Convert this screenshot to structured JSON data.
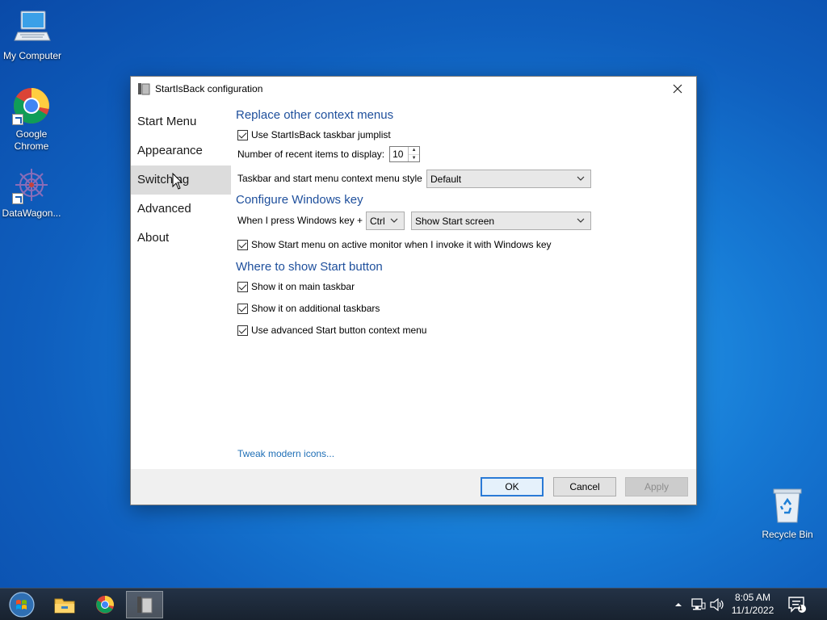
{
  "desktop": {
    "icons": [
      {
        "label": "My Computer",
        "icon": "computer-icon"
      },
      {
        "label": "Google Chrome",
        "icon": "chrome-icon"
      },
      {
        "label": "DataWagon...",
        "icon": "datawagon-icon"
      },
      {
        "label": "Recycle Bin",
        "icon": "recycle-bin-icon"
      }
    ]
  },
  "window": {
    "title": "StartIsBack configuration",
    "nav": [
      {
        "label": "Start Menu"
      },
      {
        "label": "Appearance"
      },
      {
        "label": "Switching",
        "selected": true
      },
      {
        "label": "Advanced"
      },
      {
        "label": "About"
      }
    ],
    "sections": {
      "context_menus": {
        "title": "Replace other context menus",
        "use_jumplist": {
          "label": "Use StartIsBack taskbar jumplist",
          "checked": true
        },
        "recent_items": {
          "label": "Number of recent items to display:",
          "value": "10"
        },
        "menu_style": {
          "label": "Taskbar and start menu context menu style",
          "value": "Default"
        }
      },
      "windows_key": {
        "title": "Configure Windows key",
        "press_label": "When I press Windows key +",
        "modifier": "Ctrl",
        "action": "Show Start screen",
        "active_monitor": {
          "label": "Show Start menu on active monitor when I invoke it with Windows key",
          "checked": true
        }
      },
      "start_button": {
        "title": "Where to show Start button",
        "main_taskbar": {
          "label": "Show it on main taskbar",
          "checked": true
        },
        "additional_taskbars": {
          "label": "Show it on additional taskbars",
          "checked": true
        },
        "advanced_context": {
          "label": "Use advanced Start button context menu",
          "checked": true
        }
      }
    },
    "tweak_link": "Tweak modern icons...",
    "buttons": {
      "ok": "OK",
      "cancel": "Cancel",
      "apply": "Apply"
    }
  },
  "taskbar": {
    "pinned": [
      "start-orb-icon",
      "file-explorer-icon",
      "chrome-icon",
      "startisback-config-icon"
    ],
    "tray_icons": [
      "show-hidden-icons-arrow",
      "network-icon",
      "volume-icon"
    ],
    "time": "8:05 AM",
    "date": "11/1/2022",
    "notification_count": "1"
  },
  "colors": {
    "section_title": "#1e4f9c",
    "link": "#1f6fb6",
    "nav_selected": "#dcdcdc",
    "default_button_border": "#2a7ad6"
  }
}
